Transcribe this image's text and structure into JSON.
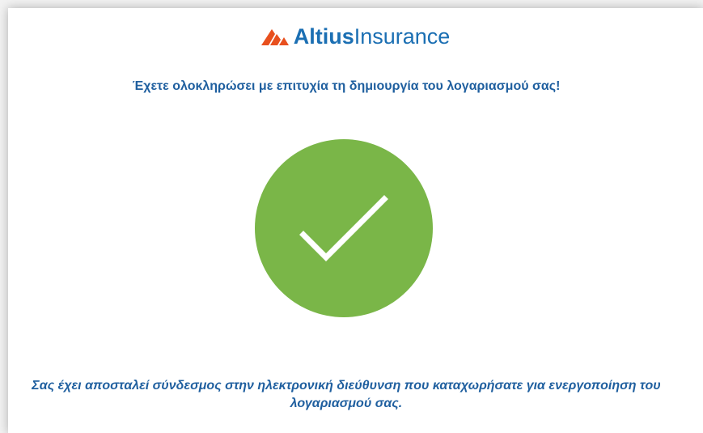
{
  "brand": {
    "name_bold": "Altius",
    "name_light": "Insurance",
    "logo_icon": "altius-stripes-logo",
    "color_blue": "#1b6fb3",
    "color_orange": "#e8501e"
  },
  "headline": "Έχετε ολοκληρώσει με επιτυχία τη δημιουργία του λογαριασμού σας!",
  "status_icon": {
    "name": "checkmark-circle-icon",
    "color": "#7ab648"
  },
  "message": "Σας έχει αποσταλεί σύνδεσμος στην ηλεκτρονική διεύθυνση που καταχωρήσατε για ενεργοποίηση του λογαριασμού σας."
}
